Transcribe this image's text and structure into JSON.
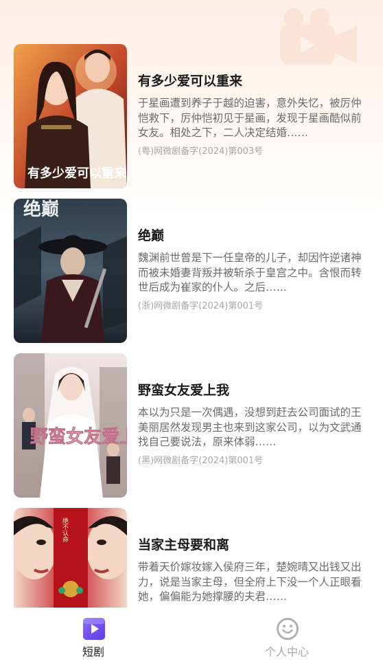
{
  "dramas": [
    {
      "title": "有多少爱可以重来",
      "description": "于星画遭到养子于越的迫害，意外失忆，被厉仲恺救下，厉仲恺初见于星画，发现于星画酷似前女友。相处之下，二人决定结婚……",
      "license": "(粤)网微剧备字(2024)第003号",
      "poster_text": "有多少爱可以重来"
    },
    {
      "title": "绝巅",
      "description": "魏渊前世曾是下一任皇帝的儿子，却因忤逆诸神而被未婚妻背叛并被斩杀于皇宫之中。含恨而转世后成为崔家的仆人。之后……",
      "license": "(浙)网微剧备字(2024)第001号",
      "poster_text": "绝巅"
    },
    {
      "title": "野蛮女友爱上我",
      "description": "本以为只是一次偶遇，没想到赶去公司面试的王美丽居然发现男主也来到这家公司，以为文武通找自己要说法，原来体弱……",
      "license": "(黑)网微剧备字(2024)第001号",
      "poster_text": "野蛮女友爱上我"
    },
    {
      "title": "当家主母要和离",
      "description": "带着天价嫁妆嫁入侯府三年，楚婉晴又出钱又出力，说是当家主母，但全府上下没一个人正眼看她，偏偏能为她撑腰的夫君……",
      "license": "",
      "poster_text": "绝不认命"
    }
  ],
  "tabbar": {
    "tabs": [
      {
        "label": "短剧",
        "icon": "play-icon",
        "active": true
      },
      {
        "label": "个人中心",
        "icon": "smile-icon",
        "active": false
      }
    ]
  },
  "colors": {
    "accent": "#6a4cf0",
    "title": "#1a1a1a",
    "description": "#6b6b6b",
    "muted": "#a8a8a8"
  }
}
